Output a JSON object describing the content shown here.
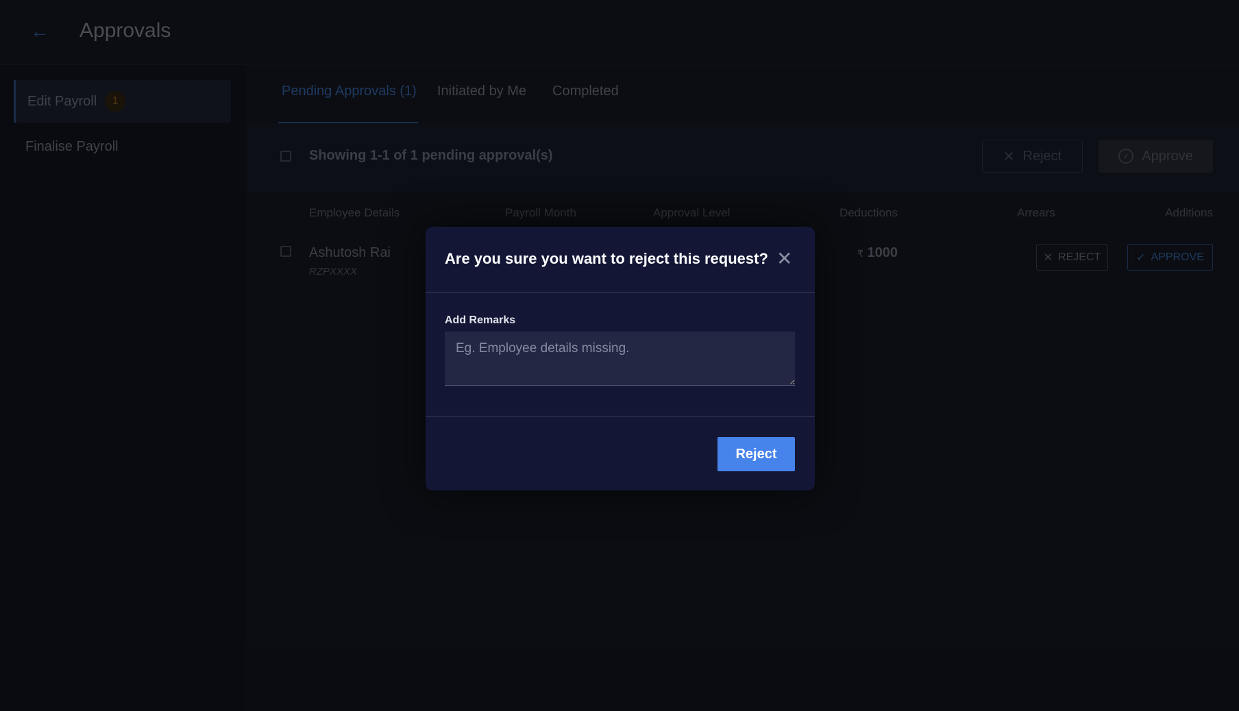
{
  "header": {
    "title": "Approvals",
    "back_icon": "arrow-left-icon"
  },
  "sidebar": {
    "items": [
      {
        "label": "Edit Payroll",
        "badge": "1",
        "active": true
      },
      {
        "label": "Finalise Payroll"
      }
    ]
  },
  "tabs": [
    {
      "label": "Pending Approvals (1)",
      "active": true
    },
    {
      "label": "Initiated by Me"
    },
    {
      "label": "Completed"
    }
  ],
  "toolbar": {
    "showing": "Showing 1-1 of 1 pending approval(s)",
    "reject": "Reject",
    "approve": "Approve"
  },
  "table": {
    "columns": [
      "Employee Details",
      "Payroll Month",
      "Approval Level",
      "Deductions",
      "Arrears",
      "Additions"
    ],
    "rows": [
      {
        "name": "Ashutosh Rai",
        "id": "RZPXXXX",
        "currency": "₹",
        "deductions": "1000",
        "reject": "REJECT",
        "approve": "APPROVE"
      }
    ]
  },
  "modal": {
    "title": "Are you sure you want to reject this request?",
    "remarks_label": "Add Remarks",
    "remarks_placeholder": "Eg. Employee details missing.",
    "remarks_value": "",
    "reject": "Reject"
  },
  "colors": {
    "primary": "#4683ea",
    "modal_bg": "#131735"
  }
}
